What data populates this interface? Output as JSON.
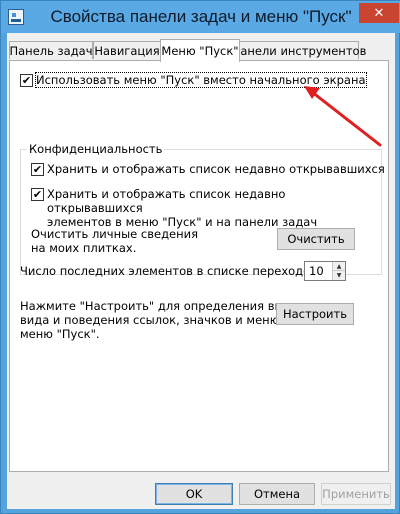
{
  "window": {
    "title": "Свойства панели задач и меню \"Пуск\"",
    "close_glyph": "✕"
  },
  "tabs": [
    {
      "label": "Панель задач",
      "active": false
    },
    {
      "label": "Навигация",
      "active": false
    },
    {
      "label": "Меню \"Пуск\"",
      "active": true
    },
    {
      "label": "Панели инструментов",
      "active": false
    }
  ],
  "start_menu": {
    "use_start_menu": {
      "label": "Использовать меню \"Пуск\" вместо начального экрана",
      "checked": true
    },
    "privacy": {
      "title": "Конфиденциальность",
      "store_recent_programs": {
        "label": "Хранить и отображать список недавно открывавшихся",
        "checked": true
      },
      "store_recent_items": {
        "line1": "Хранить и отображать список недавно открывавшихся",
        "line2": "элементов в меню \"Пуск\" и на панели задач",
        "checked": true
      },
      "clear_text_line1": "Очистить личные сведения",
      "clear_text_line2": "на моих плитках.",
      "clear_button": "Очистить"
    },
    "jump_list": {
      "label": "Число последних элементов в списке переходов:",
      "value": "10"
    },
    "customize": {
      "line1": "Нажмите \"Настроить\" для определения внешнего",
      "line2": "вида и поведения ссылок, значков и меню в",
      "line3": "меню \"Пуск\".",
      "button": "Настроить"
    }
  },
  "footer": {
    "ok": "OK",
    "cancel": "Отмена",
    "apply": "Применить"
  },
  "colors": {
    "title_bar": "#5aa9e4",
    "close_button": "#c94431",
    "annotation_arrow": "#e02020"
  }
}
